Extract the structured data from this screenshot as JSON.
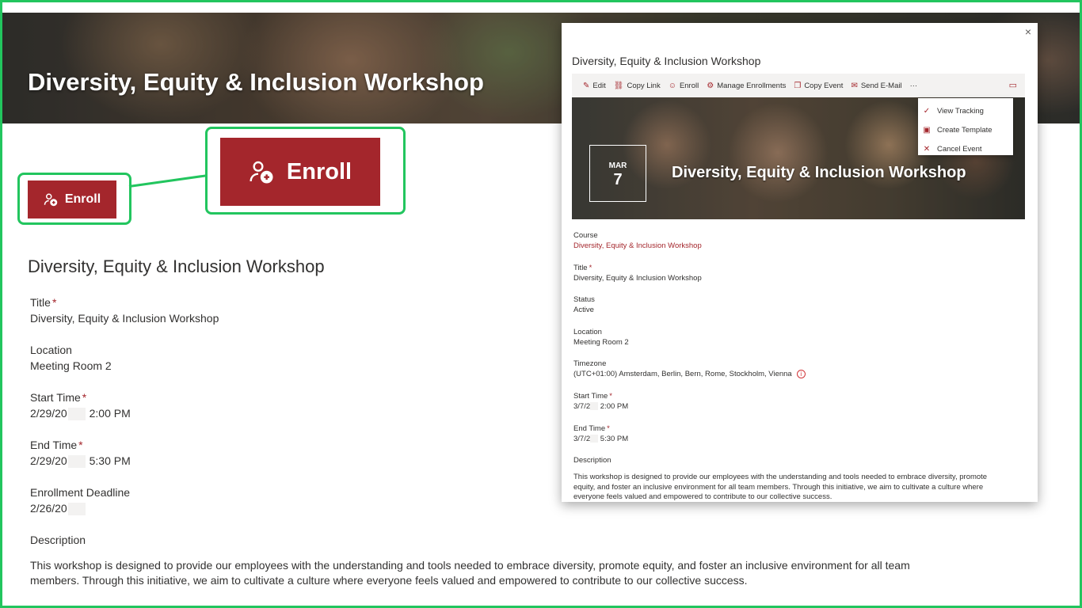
{
  "hero": {
    "title": "Diversity, Equity & Inclusion Workshop"
  },
  "enroll": {
    "label": "Enroll"
  },
  "form": {
    "heading": "Diversity, Equity & Inclusion Workshop",
    "title_label": "Title",
    "title_value": "Diversity, Equity & Inclusion Workshop",
    "location_label": "Location",
    "location_value": "Meeting Room 2",
    "start_label": "Start Time",
    "start_date": "2/29/20",
    "start_time": "2:00 PM",
    "end_label": "End Time",
    "end_date": "2/29/20",
    "end_time": "5:30 PM",
    "deadline_label": "Enrollment Deadline",
    "deadline_value": "2/26/20",
    "description_label": "Description",
    "description_text": "This workshop is designed to provide our employees with the understanding and tools needed to embrace diversity, promote equity, and foster an inclusive environment for all team members. Through this initiative, we aim to cultivate a culture where everyone feels valued and empowered to contribute to our collective success."
  },
  "panel": {
    "close": "×",
    "title": "Diversity, Equity & Inclusion Workshop",
    "commands": {
      "edit": "Edit",
      "copy_link": "Copy Link",
      "enroll": "Enroll",
      "manage": "Manage Enrollments",
      "copy_event": "Copy Event",
      "send_email": "Send E-Mail",
      "more": "···"
    },
    "menu": {
      "view_tracking": "View Tracking",
      "create_template": "Create Template",
      "cancel_event": "Cancel Event"
    },
    "date": {
      "month": "MAR",
      "day": "7"
    },
    "hero_title": "Diversity, Equity & Inclusion Workshop",
    "course_label": "Course",
    "course_value": "Diversity, Equity & Inclusion Workshop",
    "title_label": "Title",
    "title_value": "Diversity, Equity & Inclusion Workshop",
    "status_label": "Status",
    "status_value": "Active",
    "location_label": "Location",
    "location_value": "Meeting Room 2",
    "timezone_label": "Timezone",
    "timezone_value": "(UTC+01:00) Amsterdam, Berlin, Bern, Rome, Stockholm, Vienna",
    "start_label": "Start Time",
    "start_date": "3/7/2",
    "start_time": "2:00 PM",
    "end_label": "End Time",
    "end_date": "3/7/2",
    "end_time": "5:30 PM",
    "description_label": "Description",
    "description_text": "This workshop is designed to provide our employees with the understanding and tools needed to embrace diversity, promote equity, and foster an inclusive environment for all team members. Through this initiative, we aim to cultivate a culture where everyone feels valued and empowered to contribute to our collective success."
  },
  "colors": {
    "accent": "#a4262c",
    "highlight": "#22c55e"
  },
  "icons": [
    "enroll-person-add-icon",
    "edit-icon",
    "link-icon",
    "enroll-icon",
    "manage-icon",
    "copy-icon",
    "mail-icon",
    "more-icon",
    "comment-icon",
    "check-icon",
    "template-icon",
    "cancel-icon",
    "info-icon",
    "close-icon"
  ]
}
